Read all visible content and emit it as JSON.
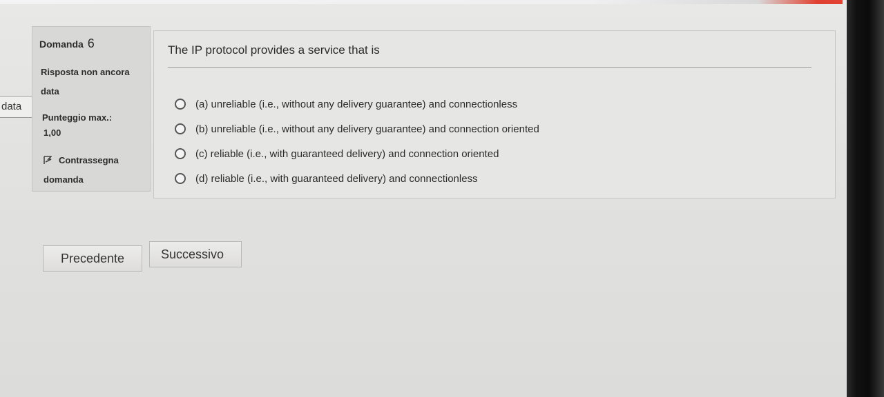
{
  "side_tab": {
    "label": "data"
  },
  "info_panel": {
    "question_label": "Domanda",
    "question_number": "6",
    "status": "Risposta non ancora data",
    "grade_label": "Punteggio max.:",
    "grade_value": "1,00",
    "flag_label": "Contrassegna domanda",
    "flag_icon": "flag-icon"
  },
  "question": {
    "text": "The IP protocol provides a service that is",
    "options": [
      {
        "label": "(a) unreliable (i.e., without any delivery guarantee) and connectionless"
      },
      {
        "label": "(b) unreliable (i.e., without any delivery guarantee) and connection oriented"
      },
      {
        "label": "(c) reliable (i.e., with guaranteed delivery) and connection oriented"
      },
      {
        "label": "(d) reliable (i.e., with guaranteed delivery) and connectionless"
      }
    ]
  },
  "navigation": {
    "previous_label": "Precedente",
    "next_label": "Successivo"
  }
}
